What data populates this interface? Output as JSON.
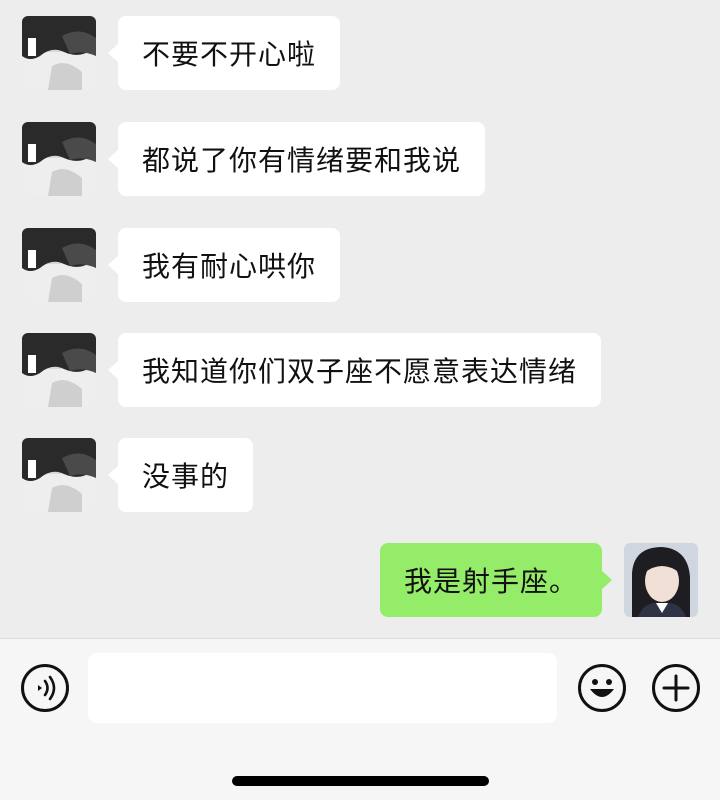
{
  "colors": {
    "chat_background": "#ededed",
    "incoming_bubble": "#ffffff",
    "outgoing_bubble": "#95ec69",
    "input_bar_background": "#f6f6f6",
    "text": "#111111"
  },
  "messages": [
    {
      "direction": "incoming",
      "avatar": "contact-avatar",
      "text": "不要不开心啦"
    },
    {
      "direction": "incoming",
      "avatar": "contact-avatar",
      "text": "都说了你有情绪要和我说"
    },
    {
      "direction": "incoming",
      "avatar": "contact-avatar",
      "text": "我有耐心哄你"
    },
    {
      "direction": "incoming",
      "avatar": "contact-avatar",
      "text": "我知道你们双子座不愿意表达情绪"
    },
    {
      "direction": "incoming",
      "avatar": "contact-avatar",
      "text": "没事的"
    },
    {
      "direction": "outgoing",
      "avatar": "my-avatar",
      "text": "我是射手座。"
    }
  ],
  "input_bar": {
    "voice_icon": "voice-icon",
    "emoji_icon": "emoji-icon",
    "plus_icon": "plus-icon",
    "input_value": "",
    "input_placeholder": ""
  }
}
